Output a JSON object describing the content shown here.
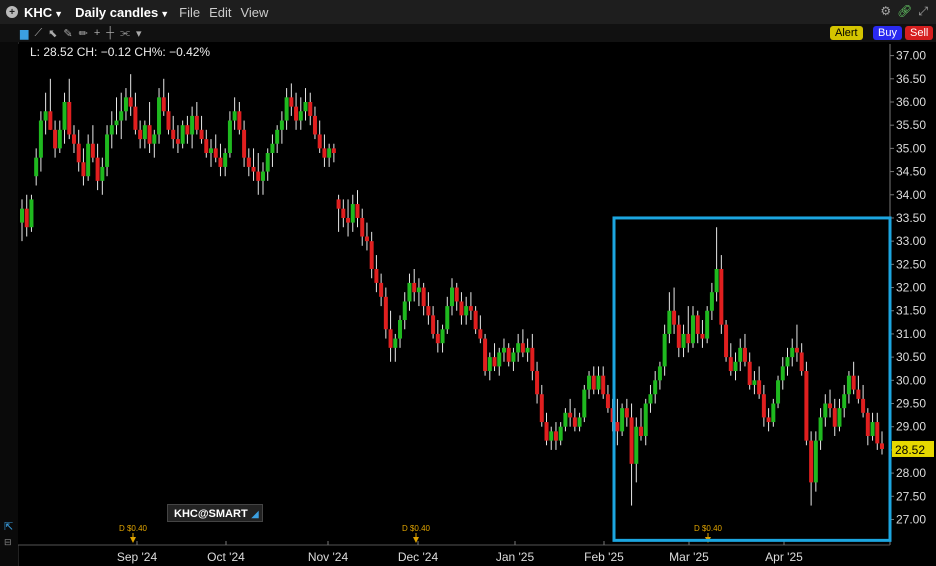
{
  "menubar": {
    "symbol": "KHC",
    "timeframe": "Daily candles",
    "menus": [
      "File",
      "Edit",
      "View"
    ]
  },
  "toolbar": {
    "alert_label": "Alert",
    "buy_label": "Buy",
    "sell_label": "Sell"
  },
  "quote": {
    "text": "L: 28.52 CH: −0.12 CH%: −0.42%"
  },
  "symbol_tag": "KHC@SMART",
  "colors": {
    "up": "#1fb91f",
    "down": "#e01f1f",
    "highlight_box": "#1ca6e0",
    "last_price": "#e6d800",
    "dividend": "#e0a400"
  },
  "chart_data": {
    "type": "candlestick",
    "y_ticks": [
      27.0,
      27.5,
      28.0,
      28.5,
      29.0,
      29.5,
      30.0,
      30.5,
      31.0,
      31.5,
      32.0,
      32.5,
      33.0,
      33.5,
      34.0,
      34.5,
      35.0,
      35.5,
      36.0,
      36.5,
      37.0
    ],
    "ylim": [
      26.45,
      37.25
    ],
    "x_labels": [
      "Sep '24",
      "Oct '24",
      "Nov '24",
      "Dec '24",
      "Jan '25",
      "Feb '25",
      "Mar '25",
      "Apr '25"
    ],
    "last_price": "28.52",
    "dividends": [
      {
        "label": "D $0.40",
        "month": "Sep '24"
      },
      {
        "label": "D $0.40",
        "month": "Dec '24"
      },
      {
        "label": "D $0.40",
        "month": "Mar '25"
      }
    ],
    "highlight": {
      "from": "Feb '25",
      "to": "latest",
      "price_low": 26.55,
      "price_high": 33.5
    },
    "ohlc": [
      [
        33.4,
        33.9,
        33.0,
        33.7
      ],
      [
        33.7,
        34.0,
        33.1,
        33.3
      ],
      [
        33.3,
        34.0,
        33.2,
        33.9
      ],
      [
        34.4,
        35.0,
        34.2,
        34.8
      ],
      [
        34.8,
        35.8,
        34.5,
        35.6
      ],
      [
        35.6,
        36.2,
        35.3,
        35.8
      ],
      [
        35.8,
        36.5,
        35.4,
        35.4
      ],
      [
        35.4,
        35.6,
        34.8,
        35.0
      ],
      [
        35.0,
        35.6,
        34.9,
        35.4
      ],
      [
        35.4,
        36.2,
        35.1,
        36.0
      ],
      [
        36.0,
        36.5,
        35.2,
        35.3
      ],
      [
        35.3,
        35.5,
        34.9,
        35.1
      ],
      [
        35.1,
        35.4,
        34.5,
        34.7
      ],
      [
        34.7,
        35.0,
        34.2,
        34.4
      ],
      [
        34.4,
        35.3,
        34.3,
        35.1
      ],
      [
        35.1,
        35.5,
        34.7,
        34.8
      ],
      [
        34.8,
        35.1,
        34.1,
        34.3
      ],
      [
        34.3,
        34.8,
        34.0,
        34.6
      ],
      [
        34.6,
        35.5,
        34.4,
        35.3
      ],
      [
        35.3,
        35.8,
        35.0,
        35.5
      ],
      [
        35.5,
        36.1,
        35.3,
        35.6
      ],
      [
        35.6,
        36.2,
        35.2,
        35.8
      ],
      [
        35.8,
        36.3,
        35.6,
        36.1
      ],
      [
        36.1,
        36.6,
        35.7,
        35.9
      ],
      [
        35.9,
        36.2,
        35.3,
        35.4
      ],
      [
        35.4,
        35.6,
        35.0,
        35.2
      ],
      [
        35.2,
        35.6,
        35.0,
        35.5
      ],
      [
        35.5,
        36.0,
        34.9,
        35.1
      ],
      [
        35.1,
        35.4,
        34.8,
        35.3
      ],
      [
        35.3,
        36.3,
        35.1,
        36.1
      ],
      [
        36.1,
        36.5,
        35.7,
        35.8
      ],
      [
        35.8,
        36.2,
        35.3,
        35.4
      ],
      [
        35.4,
        35.7,
        35.0,
        35.2
      ],
      [
        35.2,
        35.5,
        34.9,
        35.1
      ],
      [
        35.1,
        35.6,
        35.0,
        35.5
      ],
      [
        35.5,
        35.7,
        35.1,
        35.3
      ],
      [
        35.3,
        35.9,
        35.0,
        35.7
      ],
      [
        35.7,
        36.0,
        35.3,
        35.4
      ],
      [
        35.4,
        35.7,
        35.1,
        35.2
      ],
      [
        35.2,
        35.4,
        34.8,
        34.9
      ],
      [
        34.9,
        35.2,
        34.6,
        35.0
      ],
      [
        35.0,
        35.3,
        34.7,
        34.8
      ],
      [
        34.8,
        35.1,
        34.4,
        34.6
      ],
      [
        34.6,
        35.0,
        34.4,
        34.9
      ],
      [
        34.9,
        35.8,
        34.8,
        35.6
      ],
      [
        35.6,
        36.1,
        35.4,
        35.8
      ],
      [
        35.8,
        36.0,
        35.3,
        35.4
      ],
      [
        35.4,
        35.6,
        34.6,
        34.8
      ],
      [
        34.8,
        35.0,
        34.4,
        34.6
      ],
      [
        34.6,
        35.0,
        34.3,
        34.5
      ],
      [
        34.5,
        34.9,
        34.0,
        34.3
      ],
      [
        34.3,
        34.7,
        34.0,
        34.5
      ],
      [
        34.5,
        35.0,
        34.3,
        34.9
      ],
      [
        34.9,
        35.3,
        34.6,
        35.1
      ],
      [
        35.1,
        35.5,
        34.9,
        35.4
      ],
      [
        35.4,
        35.8,
        35.1,
        35.6
      ],
      [
        35.6,
        36.3,
        35.4,
        36.1
      ],
      [
        36.1,
        36.4,
        35.7,
        35.9
      ],
      [
        35.9,
        36.2,
        35.4,
        35.6
      ],
      [
        35.6,
        36.1,
        35.4,
        35.8
      ],
      [
        35.8,
        36.3,
        35.6,
        36.0
      ],
      [
        36.0,
        36.2,
        35.5,
        35.7
      ],
      [
        35.7,
        35.9,
        35.2,
        35.3
      ],
      [
        35.3,
        35.6,
        34.9,
        35.0
      ],
      [
        35.0,
        35.3,
        34.6,
        34.8
      ],
      [
        34.8,
        35.1,
        34.6,
        35.0
      ],
      [
        35.0,
        35.1,
        34.7,
        34.9
      ],
      [
        33.9,
        34.0,
        33.2,
        33.7
      ],
      [
        33.7,
        33.9,
        33.3,
        33.5
      ],
      [
        33.5,
        33.9,
        33.1,
        33.4
      ],
      [
        33.4,
        34.0,
        33.2,
        33.8
      ],
      [
        33.8,
        34.1,
        33.3,
        33.5
      ],
      [
        33.5,
        33.7,
        32.9,
        33.1
      ],
      [
        33.1,
        33.4,
        32.8,
        33.0
      ],
      [
        33.0,
        33.2,
        32.2,
        32.4
      ],
      [
        32.4,
        32.7,
        31.9,
        32.1
      ],
      [
        32.1,
        32.3,
        31.6,
        31.8
      ],
      [
        31.8,
        32.0,
        30.9,
        31.1
      ],
      [
        31.1,
        31.5,
        30.4,
        30.7
      ],
      [
        30.7,
        31.0,
        30.4,
        30.9
      ],
      [
        30.9,
        31.4,
        30.7,
        31.3
      ],
      [
        31.3,
        31.9,
        31.1,
        31.7
      ],
      [
        31.7,
        32.3,
        31.5,
        32.1
      ],
      [
        32.1,
        32.4,
        31.7,
        31.9
      ],
      [
        31.9,
        32.2,
        31.6,
        32.0
      ],
      [
        32.0,
        32.1,
        31.4,
        31.6
      ],
      [
        31.6,
        31.9,
        31.2,
        31.4
      ],
      [
        31.4,
        31.6,
        30.9,
        31.0
      ],
      [
        31.0,
        31.3,
        30.6,
        30.8
      ],
      [
        30.8,
        31.2,
        30.6,
        31.1
      ],
      [
        31.1,
        31.8,
        31.0,
        31.6
      ],
      [
        31.6,
        32.2,
        31.4,
        32.0
      ],
      [
        32.0,
        32.1,
        31.5,
        31.7
      ],
      [
        31.7,
        31.9,
        31.2,
        31.4
      ],
      [
        31.4,
        31.8,
        31.2,
        31.6
      ],
      [
        31.6,
        31.9,
        31.3,
        31.5
      ],
      [
        31.5,
        31.6,
        31.0,
        31.1
      ],
      [
        31.1,
        31.4,
        30.8,
        30.9
      ],
      [
        30.9,
        31.0,
        30.1,
        30.2
      ],
      [
        30.2,
        30.6,
        30.0,
        30.5
      ],
      [
        30.5,
        30.8,
        30.2,
        30.3
      ],
      [
        30.3,
        30.7,
        30.1,
        30.6
      ],
      [
        30.6,
        30.9,
        30.4,
        30.7
      ],
      [
        30.7,
        30.8,
        30.3,
        30.4
      ],
      [
        30.4,
        30.7,
        30.2,
        30.6
      ],
      [
        30.6,
        31.0,
        30.4,
        30.8
      ],
      [
        30.8,
        31.1,
        30.5,
        30.6
      ],
      [
        30.6,
        30.9,
        30.4,
        30.7
      ],
      [
        30.7,
        31.0,
        30.0,
        30.2
      ],
      [
        30.2,
        30.4,
        29.5,
        29.7
      ],
      [
        29.7,
        29.9,
        29.0,
        29.1
      ],
      [
        29.1,
        29.3,
        28.6,
        28.7
      ],
      [
        28.7,
        29.0,
        28.5,
        28.9
      ],
      [
        28.9,
        29.1,
        28.5,
        28.7
      ],
      [
        28.7,
        29.1,
        28.6,
        29.0
      ],
      [
        29.0,
        29.4,
        28.9,
        29.3
      ],
      [
        29.3,
        29.6,
        29.0,
        29.2
      ],
      [
        29.2,
        29.4,
        28.9,
        29.0
      ],
      [
        29.0,
        29.3,
        28.9,
        29.2
      ],
      [
        29.2,
        29.9,
        29.1,
        29.8
      ],
      [
        29.8,
        30.2,
        29.6,
        30.1
      ],
      [
        30.1,
        30.3,
        29.7,
        29.8
      ],
      [
        29.8,
        30.3,
        29.7,
        30.1
      ],
      [
        30.1,
        30.3,
        29.6,
        29.7
      ],
      [
        29.7,
        29.9,
        29.3,
        29.4
      ],
      [
        29.4,
        29.6,
        28.9,
        29.1
      ],
      [
        29.1,
        29.6,
        28.6,
        28.9
      ],
      [
        28.9,
        29.5,
        28.8,
        29.4
      ],
      [
        29.4,
        29.6,
        29.0,
        29.2
      ],
      [
        29.2,
        29.5,
        27.3,
        28.2
      ],
      [
        28.2,
        29.2,
        27.8,
        29.0
      ],
      [
        29.0,
        29.4,
        28.7,
        28.8
      ],
      [
        28.8,
        29.6,
        28.6,
        29.5
      ],
      [
        29.5,
        29.9,
        29.3,
        29.7
      ],
      [
        29.7,
        30.2,
        29.5,
        30.0
      ],
      [
        30.0,
        30.4,
        29.8,
        30.3
      ],
      [
        30.3,
        31.2,
        30.1,
        31.0
      ],
      [
        31.0,
        31.9,
        30.8,
        31.5
      ],
      [
        31.5,
        32.0,
        31.0,
        31.2
      ],
      [
        31.2,
        31.4,
        30.5,
        30.7
      ],
      [
        30.7,
        31.2,
        30.5,
        31.0
      ],
      [
        31.0,
        31.6,
        30.6,
        30.8
      ],
      [
        30.8,
        31.6,
        30.7,
        31.4
      ],
      [
        31.4,
        31.5,
        30.8,
        31.0
      ],
      [
        31.0,
        31.3,
        30.7,
        30.9
      ],
      [
        30.9,
        31.6,
        30.8,
        31.5
      ],
      [
        31.5,
        32.1,
        31.3,
        31.9
      ],
      [
        31.9,
        33.3,
        31.7,
        32.4
      ],
      [
        32.4,
        32.7,
        31.0,
        31.2
      ],
      [
        31.2,
        31.3,
        30.4,
        30.5
      ],
      [
        30.5,
        30.8,
        30.1,
        30.2
      ],
      [
        30.2,
        30.6,
        30.0,
        30.4
      ],
      [
        30.4,
        30.9,
        30.2,
        30.7
      ],
      [
        30.7,
        31.0,
        30.3,
        30.4
      ],
      [
        30.4,
        30.6,
        29.8,
        29.9
      ],
      [
        29.9,
        30.2,
        29.7,
        30.0
      ],
      [
        30.0,
        30.3,
        29.6,
        29.7
      ],
      [
        29.7,
        29.9,
        29.0,
        29.2
      ],
      [
        29.2,
        29.4,
        28.9,
        29.1
      ],
      [
        29.1,
        29.6,
        29.0,
        29.5
      ],
      [
        29.5,
        30.1,
        29.4,
        30.0
      ],
      [
        30.0,
        30.5,
        29.8,
        30.3
      ],
      [
        30.3,
        30.7,
        30.1,
        30.5
      ],
      [
        30.5,
        30.9,
        30.3,
        30.7
      ],
      [
        30.7,
        31.2,
        30.4,
        30.6
      ],
      [
        30.6,
        30.8,
        30.1,
        30.2
      ],
      [
        30.2,
        30.4,
        28.6,
        28.7
      ],
      [
        28.7,
        28.9,
        27.3,
        27.8
      ],
      [
        27.8,
        28.9,
        27.6,
        28.7
      ],
      [
        28.7,
        29.4,
        28.5,
        29.2
      ],
      [
        29.2,
        29.7,
        29.0,
        29.5
      ],
      [
        29.5,
        29.8,
        29.2,
        29.4
      ],
      [
        29.4,
        29.6,
        28.8,
        29.0
      ],
      [
        29.0,
        29.6,
        28.9,
        29.4
      ],
      [
        29.4,
        29.9,
        29.2,
        29.7
      ],
      [
        29.7,
        30.2,
        29.5,
        30.1
      ],
      [
        30.1,
        30.4,
        29.7,
        29.8
      ],
      [
        29.8,
        30.1,
        29.5,
        29.6
      ],
      [
        29.6,
        29.9,
        29.2,
        29.3
      ],
      [
        29.3,
        29.4,
        28.6,
        28.8
      ],
      [
        28.8,
        29.3,
        28.7,
        29.1
      ],
      [
        29.1,
        29.3,
        28.5,
        28.64
      ],
      [
        28.64,
        28.9,
        28.4,
        28.52
      ]
    ]
  }
}
